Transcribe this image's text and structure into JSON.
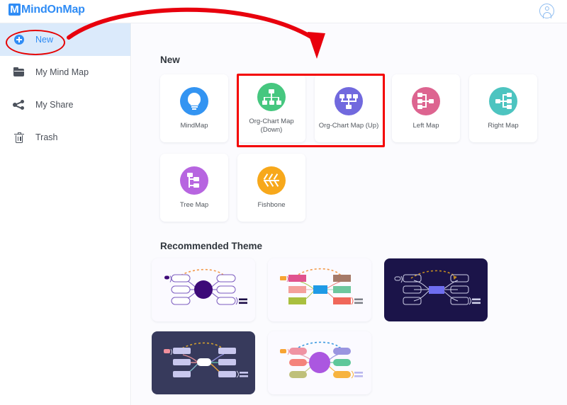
{
  "header": {
    "logo_text": "MindOnMap",
    "logo_mark": "M",
    "avatar_icon": "user-avatar-icon"
  },
  "sidebar": {
    "items": [
      {
        "label": "New",
        "icon": "plus-circle-icon",
        "active": true
      },
      {
        "label": "My Mind Map",
        "icon": "folder-icon",
        "active": false
      },
      {
        "label": "My Share",
        "icon": "share-icon",
        "active": false
      },
      {
        "label": "Trash",
        "icon": "trash-icon",
        "active": false
      }
    ]
  },
  "main": {
    "new_section": {
      "title": "New",
      "cards": [
        {
          "label": "MindMap",
          "icon": "lightbulb-icon",
          "color": "#3394f2"
        },
        {
          "label": "Org-Chart Map\n(Down)",
          "icon": "org-chart-down-icon",
          "color": "#46c77f"
        },
        {
          "label": "Org-Chart Map (Up)",
          "icon": "org-chart-up-icon",
          "color": "#7169de"
        },
        {
          "label": "Left Map",
          "icon": "left-map-icon",
          "color": "#dd6490"
        },
        {
          "label": "Right Map",
          "icon": "right-map-icon",
          "color": "#4dc4c0"
        },
        {
          "label": "Tree Map",
          "icon": "tree-map-icon",
          "color": "#b765e0"
        },
        {
          "label": "Fishbone",
          "icon": "fishbone-icon",
          "color": "#f7a81b"
        }
      ]
    },
    "theme_section": {
      "title": "Recommended Theme",
      "themes": [
        {
          "name": "theme-purple-circle-light",
          "background": "#fbfaff",
          "accent": "#3d0a78"
        },
        {
          "name": "theme-colorful-blocks-light",
          "background": "#fbfaff",
          "accent": "#1f9ae6"
        },
        {
          "name": "theme-navy-dark",
          "background": "#1b1449",
          "accent": "#6f6ef0"
        },
        {
          "name": "theme-slate-dark",
          "background": "#373a5c",
          "accent": "#ffffff"
        },
        {
          "name": "theme-violet-circle-light",
          "background": "#fbfaff",
          "accent": "#ab57e0"
        }
      ]
    }
  },
  "annotations": {
    "ellipse_target": "New",
    "rectangle_targets": "Org-Chart Map (Down), Org-Chart Map (Up)",
    "arrow_color": "#e8000d",
    "highlight_color": "#f40000"
  }
}
